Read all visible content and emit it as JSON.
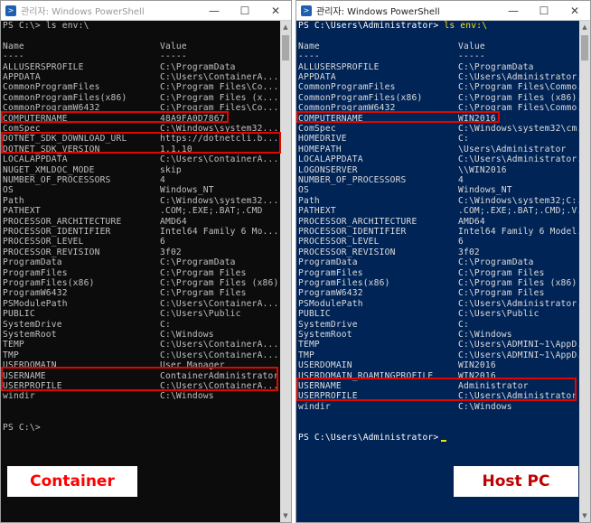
{
  "left": {
    "title": "관리자: Windows PowerShell",
    "controls": [
      "—",
      "☐",
      "✕"
    ],
    "prompt_line": "PS C:\\> ls env:\\",
    "header": [
      "Name",
      "Value"
    ],
    "rule": [
      "----",
      "-----"
    ],
    "rows": [
      [
        "ALLUSERSPROFILE",
        "C:\\ProgramData"
      ],
      [
        "APPDATA",
        "C:\\Users\\ContainerA..."
      ],
      [
        "CommonProgramFiles",
        "C:\\Program Files\\Co..."
      ],
      [
        "CommonProgramFiles(x86)",
        "C:\\Program Files (x..."
      ],
      [
        "CommonProgramW6432",
        "C:\\Program Files\\Co..."
      ],
      [
        "COMPUTERNAME",
        "48A9FA0D7867"
      ],
      [
        "ComSpec",
        "C:\\Windows\\system32..."
      ],
      [
        "DOTNET_SDK_DOWNLOAD_URL",
        "https://dotnetcli.b..."
      ],
      [
        "DOTNET_SDK_VERSION",
        "1.1.10"
      ],
      [
        "LOCALAPPDATA",
        "C:\\Users\\ContainerA..."
      ],
      [
        "NUGET_XMLDOC_MODE",
        "skip"
      ],
      [
        "NUMBER_OF_PROCESSORS",
        "4"
      ],
      [
        "OS",
        "Windows_NT"
      ],
      [
        "Path",
        "C:\\Windows\\system32..."
      ],
      [
        "PATHEXT",
        ".COM;.EXE;.BAT;.CMD"
      ],
      [
        "PROCESSOR_ARCHITECTURE",
        "AMD64"
      ],
      [
        "PROCESSOR_IDENTIFIER",
        "Intel64 Family 6 Mo..."
      ],
      [
        "PROCESSOR_LEVEL",
        "6"
      ],
      [
        "PROCESSOR_REVISION",
        "3f02"
      ],
      [
        "ProgramData",
        "C:\\ProgramData"
      ],
      [
        "ProgramFiles",
        "C:\\Program Files"
      ],
      [
        "ProgramFiles(x86)",
        "C:\\Program Files (x86)"
      ],
      [
        "ProgramW6432",
        "C:\\Program Files"
      ],
      [
        "PSModulePath",
        "C:\\Users\\ContainerA..."
      ],
      [
        "PUBLIC",
        "C:\\Users\\Public"
      ],
      [
        "SystemDrive",
        "C:"
      ],
      [
        "SystemRoot",
        "C:\\Windows"
      ],
      [
        "TEMP",
        "C:\\Users\\ContainerA..."
      ],
      [
        "TMP",
        "C:\\Users\\ContainerA..."
      ],
      [
        "USERDOMAIN",
        "User Manager"
      ],
      [
        "USERNAME",
        "ContainerAdministrator"
      ],
      [
        "USERPROFILE",
        "C:\\Users\\ContainerA..."
      ],
      [
        "windir",
        "C:\\Windows"
      ]
    ],
    "end_prompt": "PS C:\\>",
    "caption": "Container"
  },
  "right": {
    "title": "관리자: Windows PowerShell",
    "controls": [
      "—",
      "☐",
      "✕"
    ],
    "prompt": "PS C:\\Users\\Administrator>",
    "command": "ls env:\\",
    "header": [
      "Name",
      "Value"
    ],
    "rule": [
      "----",
      "-----"
    ],
    "rows": [
      [
        "ALLUSERSPROFILE",
        "C:\\ProgramData"
      ],
      [
        "APPDATA",
        "C:\\Users\\Administrator..."
      ],
      [
        "CommonProgramFiles",
        "C:\\Program Files\\Commo..."
      ],
      [
        "CommonProgramFiles(x86)",
        "C:\\Program Files (x86)..."
      ],
      [
        "CommonProgramW6432",
        "C:\\Program Files\\Commo..."
      ],
      [
        "COMPUTERNAME",
        "WIN2016"
      ],
      [
        "ComSpec",
        "C:\\Windows\\system32\\cm..."
      ],
      [
        "HOMEDRIVE",
        "C:"
      ],
      [
        "HOMEPATH",
        "\\Users\\Administrator"
      ],
      [
        "LOCALAPPDATA",
        "C:\\Users\\Administrator..."
      ],
      [
        "LOGONSERVER",
        "\\\\WIN2016"
      ],
      [
        "NUMBER_OF_PROCESSORS",
        "4"
      ],
      [
        "OS",
        "Windows_NT"
      ],
      [
        "Path",
        "C:\\Windows\\system32;C:..."
      ],
      [
        "PATHEXT",
        ".COM;.EXE;.BAT;.CMD;.V..."
      ],
      [
        "PROCESSOR_ARCHITECTURE",
        "AMD64"
      ],
      [
        "PROCESSOR_IDENTIFIER",
        "Intel64 Family 6 Model..."
      ],
      [
        "PROCESSOR_LEVEL",
        "6"
      ],
      [
        "PROCESSOR_REVISION",
        "3f02"
      ],
      [
        "ProgramData",
        "C:\\ProgramData"
      ],
      [
        "ProgramFiles",
        "C:\\Program Files"
      ],
      [
        "ProgramFiles(x86)",
        "C:\\Program Files (x86)"
      ],
      [
        "ProgramW6432",
        "C:\\Program Files"
      ],
      [
        "PSModulePath",
        "C:\\Users\\Administrator..."
      ],
      [
        "PUBLIC",
        "C:\\Users\\Public"
      ],
      [
        "SystemDrive",
        "C:"
      ],
      [
        "SystemRoot",
        "C:\\Windows"
      ],
      [
        "TEMP",
        "C:\\Users\\ADMINI~1\\AppD..."
      ],
      [
        "TMP",
        "C:\\Users\\ADMINI~1\\AppD..."
      ],
      [
        "USERDOMAIN",
        "WIN2016"
      ],
      [
        "USERDOMAIN_ROAMINGPROFILE",
        "WIN2016"
      ],
      [
        "USERNAME",
        "Administrator"
      ],
      [
        "USERPROFILE",
        "C:\\Users\\Administrator"
      ],
      [
        "windir",
        "C:\\Windows"
      ]
    ],
    "end_prompt": "PS C:\\Users\\Administrator>",
    "caption": "Host PC"
  },
  "colors": {
    "container_console_bg": "#0c0c0c",
    "host_console_bg": "#012456",
    "highlight_border": "#e10600",
    "caption_text": "#ff0000"
  },
  "icons": [
    "powershell-icon",
    "minimize-icon",
    "maximize-icon",
    "close-icon"
  ]
}
